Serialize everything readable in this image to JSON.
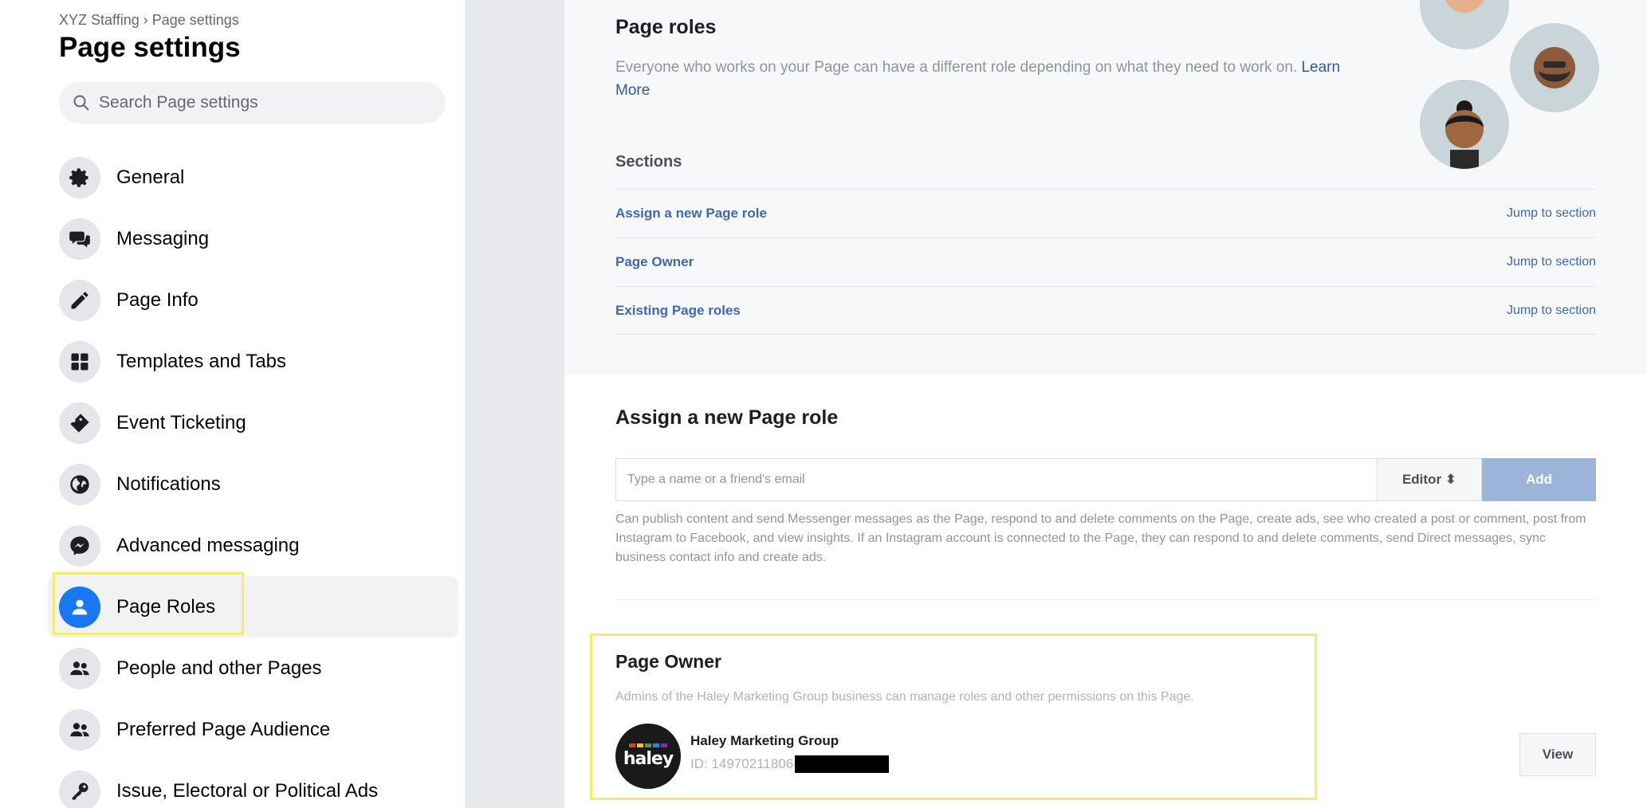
{
  "sidebar": {
    "breadcrumb": "XYZ Staffing › Page settings",
    "title": "Page settings",
    "search_placeholder": "Search Page settings",
    "items": [
      {
        "label": "General",
        "icon": "gear-icon"
      },
      {
        "label": "Messaging",
        "icon": "chat-bubbles-icon"
      },
      {
        "label": "Page Info",
        "icon": "pencil-icon"
      },
      {
        "label": "Templates and Tabs",
        "icon": "grid-icon"
      },
      {
        "label": "Event Ticketing",
        "icon": "ticket-icon"
      },
      {
        "label": "Notifications",
        "icon": "globe-icon"
      },
      {
        "label": "Advanced messaging",
        "icon": "messenger-icon"
      },
      {
        "label": "Page Roles",
        "icon": "person-icon",
        "active": true
      },
      {
        "label": "People and other Pages",
        "icon": "people-icon"
      },
      {
        "label": "Preferred Page Audience",
        "icon": "people-icon"
      },
      {
        "label": "Issue, Electoral or Political Ads",
        "icon": "key-icon"
      }
    ]
  },
  "main": {
    "roles_title": "Page roles",
    "roles_desc": "Everyone who works on your Page can have a different role depending on what they need to work on.",
    "learn_more": "Learn More",
    "sections_label": "Sections",
    "sections": [
      {
        "label": "Assign a new Page role",
        "jump": "Jump to section"
      },
      {
        "label": "Page Owner",
        "jump": "Jump to section"
      },
      {
        "label": "Existing Page roles",
        "jump": "Jump to section"
      }
    ],
    "assign": {
      "title": "Assign a new Page role",
      "input_placeholder": "Type a name or a friend's email",
      "role_value": "Editor ⬍",
      "add_label": "Add",
      "help": "Can publish content and send Messenger messages as the Page, respond to and delete comments on the Page, create ads, see who created a post or comment, post from Instagram to Facebook, and view insights. If an Instagram account is connected to the Page, they can respond to and delete comments, send Direct messages, sync business contact info and create ads."
    },
    "owner": {
      "title": "Page Owner",
      "desc": "Admins of the Haley Marketing Group business can manage roles and other permissions on this Page.",
      "logo_text": "haley",
      "name": "Haley Marketing Group",
      "id_text": "ID: 14970211806",
      "view_label": "View"
    }
  },
  "colors": {
    "accent": "#1877f2",
    "link": "#4267b2",
    "highlight": "#f2ec6f",
    "add_button": "#9cb4d8"
  }
}
